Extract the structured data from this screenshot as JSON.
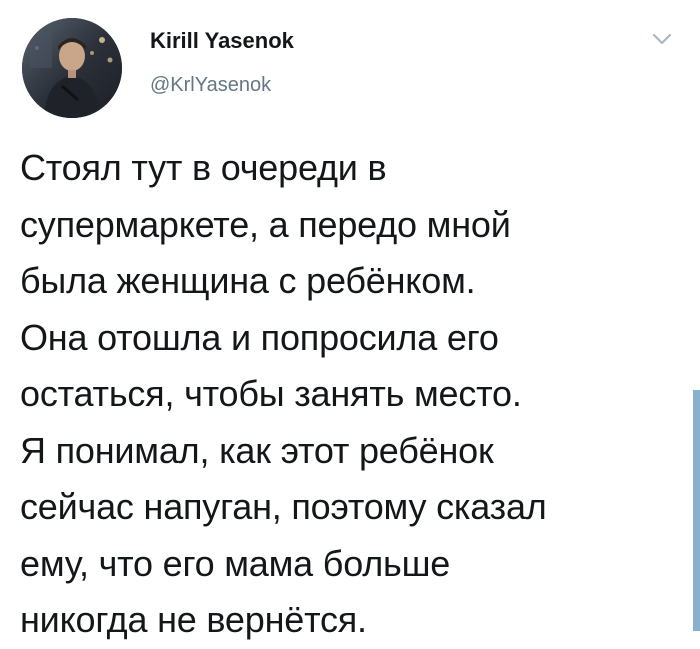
{
  "tweet": {
    "author": {
      "display_name": "Kirill Yasenok",
      "handle": "@KrlYasenok",
      "avatar_icon": "user-avatar-photo"
    },
    "menu_icon": "chevron-down-icon",
    "text": "Стоял тут в очереди в\nсупермаркете, а передо мной\nбыла женщина с ребёнком.\nОна отошла и попросила его\nостаться, чтобы занять место.\nЯ понимал, как этот ребёнок\nсейчас напуган, поэтому сказал\nему, что его мама больше\nникогда не вернётся."
  },
  "colors": {
    "text": "#14171a",
    "secondary_text": "#657786",
    "background": "#ffffff"
  }
}
